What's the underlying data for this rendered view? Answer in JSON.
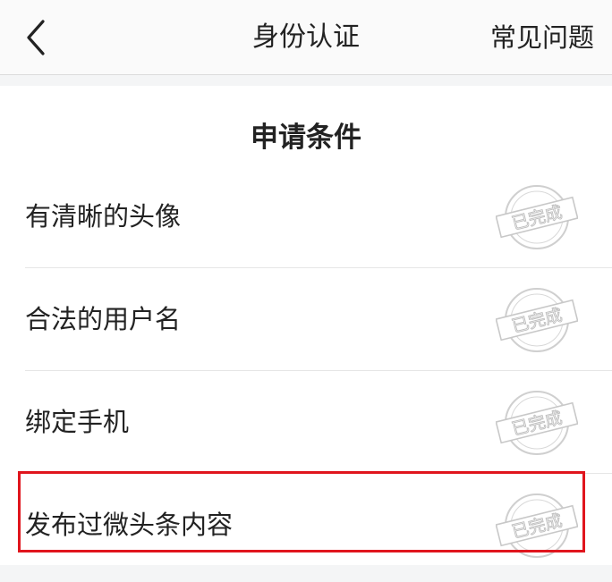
{
  "nav": {
    "title": "身份认证",
    "faq_label": "常见问题"
  },
  "section": {
    "title": "申请条件"
  },
  "conditions": [
    {
      "label": "有清晰的头像",
      "status": "已完成"
    },
    {
      "label": "合法的用户名",
      "status": "已完成"
    },
    {
      "label": "绑定手机",
      "status": "已完成"
    },
    {
      "label": "发布过微头条内容",
      "status": "已完成"
    }
  ],
  "colors": {
    "highlight": "#e0151d",
    "stamp": "#c8c8c8"
  }
}
